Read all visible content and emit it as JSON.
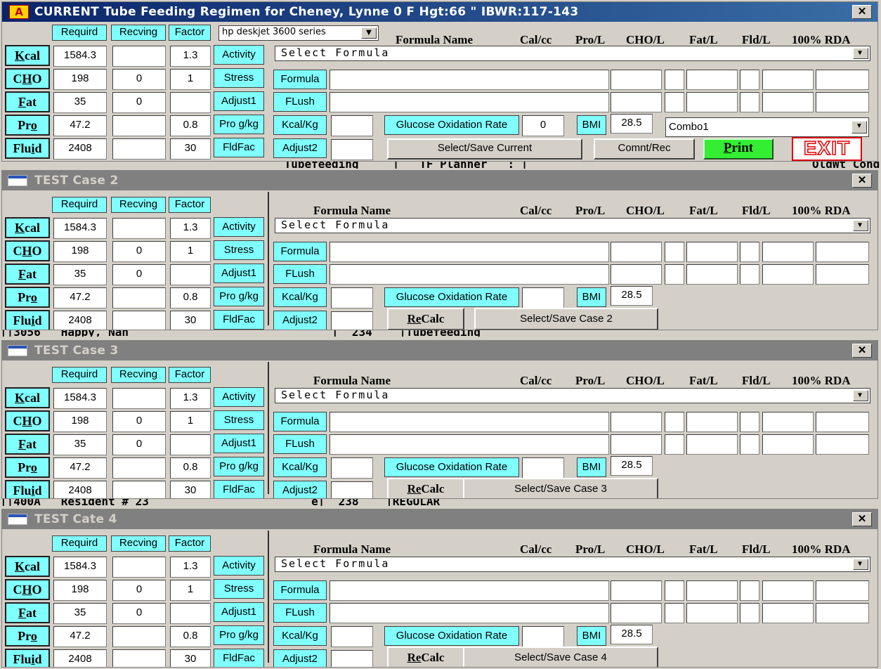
{
  "windows": [
    {
      "key": "current",
      "title": "CURRENT Tube Feeding Regimen for Cheney, Lynne  0  F   Hgt:66   \"  IBWR:117-143",
      "active": true,
      "close_label": "✕"
    },
    {
      "key": "case2",
      "title": "TEST Case 2",
      "active": false,
      "close_label": "✕"
    },
    {
      "key": "case3",
      "title": "TEST Case 3",
      "active": false,
      "close_label": "✕"
    },
    {
      "key": "case4",
      "title": "TEST Cate 4",
      "active": false,
      "close_label": "✕"
    }
  ],
  "app_icon_letter": "A",
  "column_headers": {
    "required": "Requird",
    "receiving": "Recving",
    "factor": "Factor"
  },
  "rows": [
    {
      "label_html": "K",
      "label_rest": "cal",
      "label": "Kcal",
      "required": "1584.3",
      "receiving": "",
      "factor": "1.3",
      "right_label": "Activity"
    },
    {
      "label": "CHO",
      "required": "198",
      "receiving": "0",
      "factor": "1",
      "right_label": "Stress"
    },
    {
      "label": "Fat",
      "required": "35",
      "receiving": "0",
      "factor": "",
      "right_label": "Adjust1"
    },
    {
      "label": "Pro",
      "required": "47.2",
      "receiving": "",
      "factor": "0.8",
      "right_label": "Pro g/kg"
    },
    {
      "label": "Fluid",
      "required": "2408",
      "receiving": "",
      "factor": "30",
      "right_label": "FldFac"
    }
  ],
  "printer_select": "hp deskjet 3600 series",
  "formula_headers": {
    "name": "Formula Name",
    "cal": "Cal/cc",
    "pro": "Pro/L",
    "cho": "CHO/L",
    "fat": "Fat/L",
    "fld": "Fld/L",
    "rda": "100% RDA"
  },
  "select_formula": "Select  Formula",
  "labels": {
    "formula": "Formula",
    "flush": "FLush",
    "kcal_kg": "Kcal/Kg",
    "adjust2": "Adjust2",
    "glucose": "Glucose Oxidation Rate",
    "bmi": "BMI"
  },
  "current": {
    "glucose_value": "0",
    "bmi_value": "28.5",
    "combo": "Combo1",
    "select_save": "Select/Save Current",
    "comnt": "Comnt/Rec",
    "print": "Print",
    "exit": "EXIT"
  },
  "cases": [
    {
      "bmi_value": "28.5",
      "recalc": "ReCalc",
      "select_save": "Select/Save Case 2"
    },
    {
      "bmi_value": "28.5",
      "recalc": "ReCalc",
      "select_save": "Select/Save Case 3"
    },
    {
      "bmi_value": "28.5",
      "recalc": "ReCalc",
      "select_save": "Select/Save Case 4"
    }
  ],
  "background_text": {
    "strip1": "                                          Tubefeeding     |   TF Planner   : |                                          OldWt Cond        Mealconsp.",
    "strip2": "||3056   Happy, Nan                              |  234    |Tubefeeding",
    "strip3": "||400A   Resident # 23                        e|  238    |REGULAR"
  }
}
